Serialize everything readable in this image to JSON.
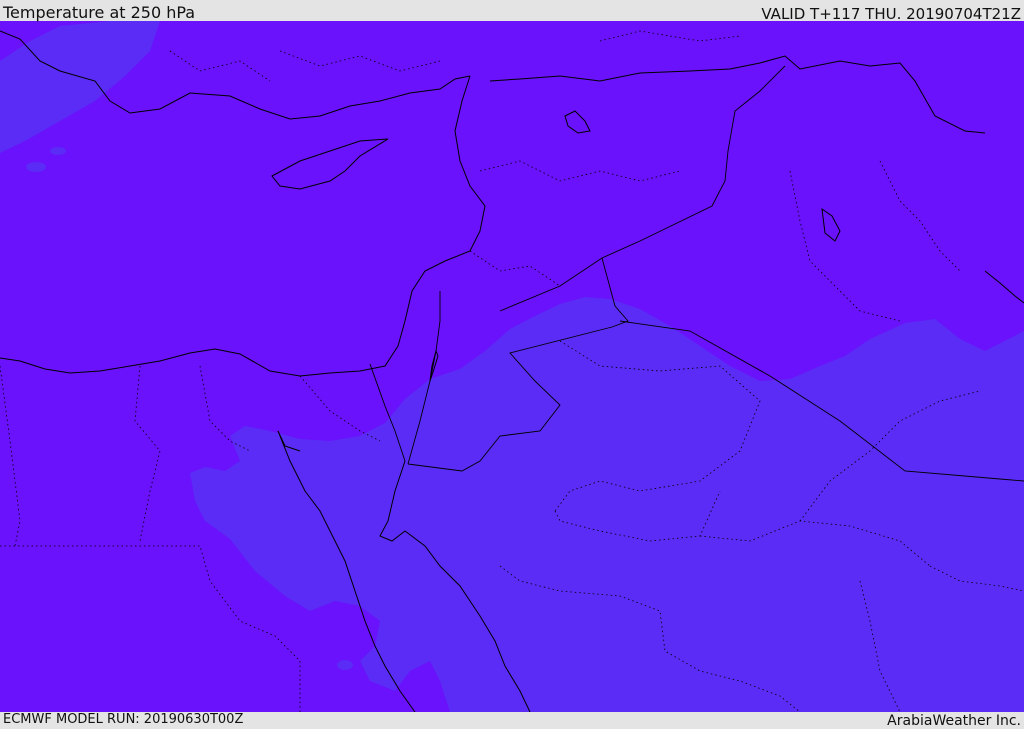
{
  "header": {
    "title": "Temperature at 250 hPa",
    "valid_time": "VALID T+117 THU. 20190704T21Z"
  },
  "footer": {
    "model_run": "ECMWF MODEL RUN: 20190630T00Z",
    "credit": "ArabiaWeather Inc."
  },
  "colors": {
    "warm_field": "#6a12fb",
    "cool_field": "#5a2cf6",
    "coastline": "#000000",
    "frame": "#e4e4e4"
  }
}
